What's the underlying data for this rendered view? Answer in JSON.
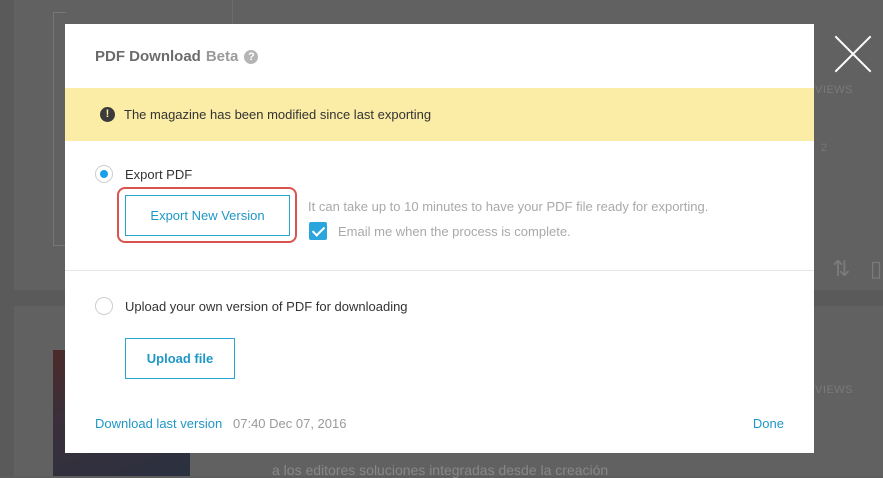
{
  "modal": {
    "title": "PDF Download",
    "title_badge": "Beta",
    "help_icon": "?",
    "warning_icon": "!",
    "warning_text": "The magazine has been modified since last exporting",
    "option_export": {
      "label": "Export PDF",
      "selected": true,
      "button_label": "Export New Version",
      "info_text": "It can take up to 10 minutes to have your PDF file ready for exporting.",
      "email_label": "Email me when the process is complete.",
      "email_checked": true
    },
    "option_upload": {
      "label": "Upload your own version of PDF for downloading",
      "selected": false,
      "button_label": "Upload file"
    },
    "footer": {
      "download_link": "Download last version",
      "timestamp": "07:40 Dec 07, 2016",
      "done_label": "Done"
    }
  },
  "background": {
    "views_label_1": "VIEWS",
    "views_label_2": "VIEWS",
    "small_label": "2",
    "text_line": "a los editores soluciones integradas desde la creación"
  },
  "colors": {
    "accent": "#1f97c6",
    "warning_bg": "#fbeca6",
    "highlight": "#d9534f",
    "overlay": "#5a5a5a"
  },
  "icons": [
    "help-icon",
    "warning-icon",
    "close-icon",
    "checkmark-icon",
    "sort-icon",
    "trash-icon"
  ]
}
